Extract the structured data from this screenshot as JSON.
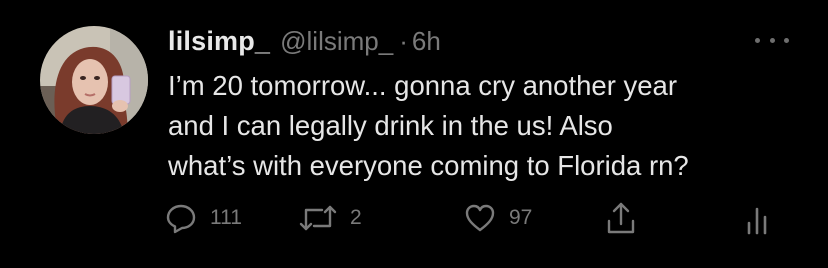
{
  "tweet": {
    "display_name": "lilsimp_",
    "handle": "@lilsimp_",
    "separator": "·",
    "time": "6h",
    "body_lines": [
      "I’m 20 tomorrow... gonna cry another year",
      "and I can legally drink in the us! Also",
      "what’s with everyone coming to Florida rn?"
    ],
    "replies": "111",
    "retweets": "2",
    "likes": "97"
  },
  "icons": {
    "more": "more-icon",
    "reply": "reply-icon",
    "retweet": "retweet-icon",
    "like": "heart-icon",
    "share": "share-icon",
    "analytics": "analytics-icon"
  },
  "colors": {
    "background": "#000000",
    "text": "#e6e6e6",
    "secondary": "#7a7a7a"
  }
}
